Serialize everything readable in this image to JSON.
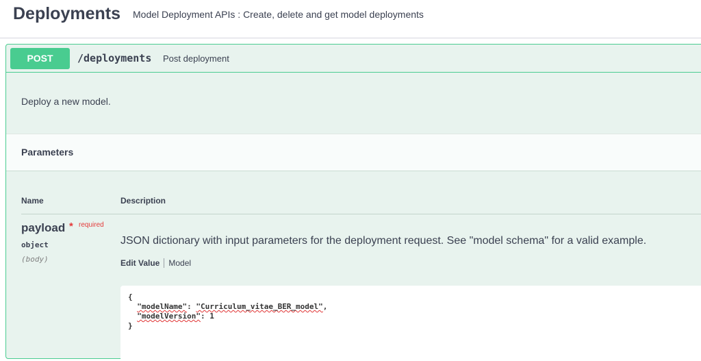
{
  "tag": {
    "title": "Deployments",
    "description": "Model Deployment APIs : Create, delete and get model deployments"
  },
  "operation": {
    "method": "POST",
    "path": "/deployments",
    "summary": "Post deployment",
    "description": "Deploy a new model.",
    "method_color": "#49cc90"
  },
  "parameters": {
    "title": "Parameters",
    "columns": {
      "name": "Name",
      "description": "Description"
    },
    "items": [
      {
        "name": "payload",
        "required_star": "*",
        "required_label": "required",
        "type": "object",
        "in": "(body)",
        "description": "JSON dictionary with input parameters for the deployment request. See \"model schema\" for a valid example.",
        "tabs": {
          "edit": "Edit Value",
          "model": "Model"
        },
        "example": {
          "open": "{",
          "key1": "\"modelName\"",
          "val1": "\"Curriculum_vitae_BER_model\"",
          "key2": "\"modelVersion\"",
          "val2": "1",
          "close": "}"
        }
      }
    ]
  }
}
